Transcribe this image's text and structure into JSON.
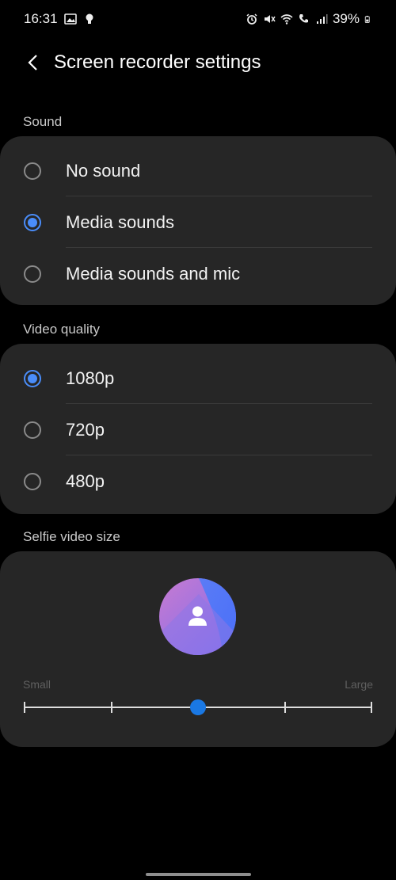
{
  "status_bar": {
    "time": "16:31",
    "battery": "39%",
    "icons_left": [
      "gallery-icon",
      "bulb-icon"
    ],
    "icons_right": [
      "alarm-icon",
      "mute-icon",
      "wifi-icon",
      "wifi-call-icon",
      "signal-icon",
      "battery-icon"
    ]
  },
  "header": {
    "title": "Screen recorder settings"
  },
  "sound": {
    "label": "Sound",
    "options": [
      {
        "label": "No sound",
        "checked": false
      },
      {
        "label": "Media sounds",
        "checked": true
      },
      {
        "label": "Media sounds and mic",
        "checked": false
      }
    ]
  },
  "video_quality": {
    "label": "Video quality",
    "options": [
      {
        "label": "1080p",
        "checked": true
      },
      {
        "label": "720p",
        "checked": false
      },
      {
        "label": "480p",
        "checked": false
      }
    ]
  },
  "selfie": {
    "label": "Selfie video size",
    "min_label": "Small",
    "max_label": "Large",
    "steps": 5,
    "value_step": 2
  },
  "colors": {
    "accent": "#4a8dfa",
    "card": "#262626",
    "background": "#000000"
  }
}
